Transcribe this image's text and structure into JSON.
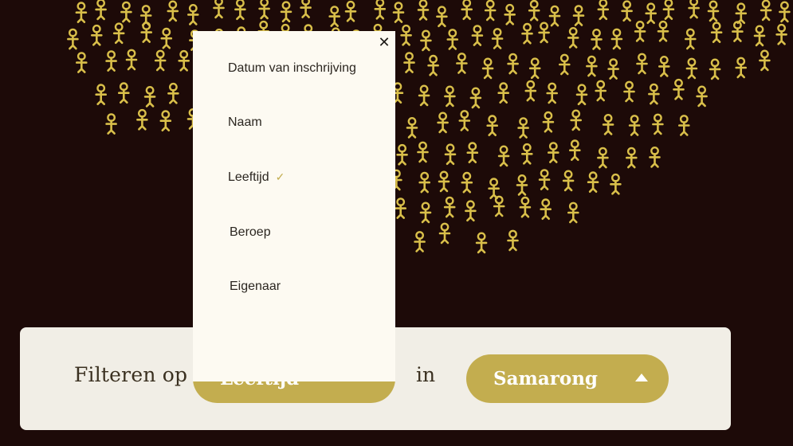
{
  "filter": {
    "label": "Filteren op",
    "in_label": "in",
    "selected_filter": "Leeftijd",
    "selected_place": "Samarong"
  },
  "dropdown": {
    "options": [
      "Datum van inschrijving",
      "Naam",
      "Leeftijd",
      "Beroep",
      "Eigenaar"
    ],
    "selected_index": 2
  },
  "colors": {
    "background": "#1d0a08",
    "figure": "#d9bf4a",
    "accent": "#c3ad4f"
  }
}
